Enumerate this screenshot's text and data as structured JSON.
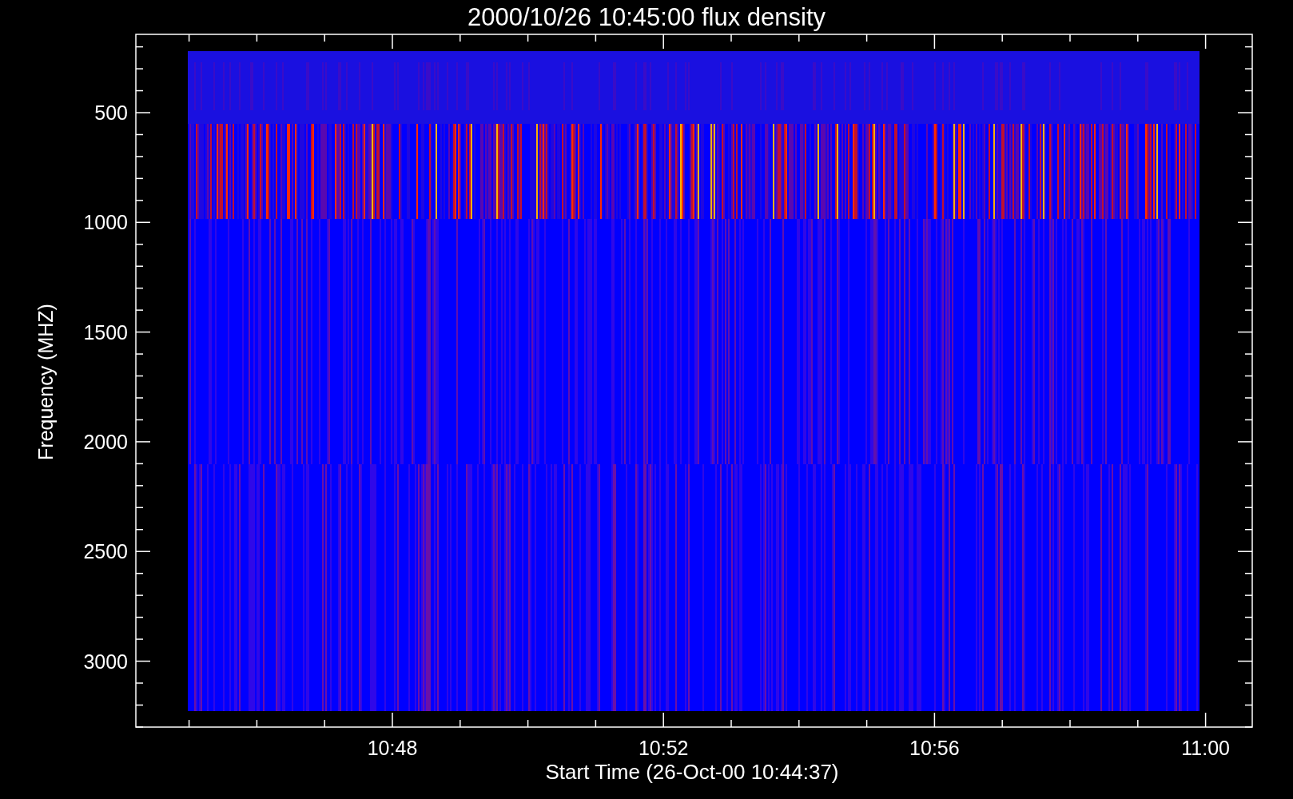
{
  "plot": {
    "title": "2000/10/26 10:45:00 flux density",
    "xlabel": "Start Time (26-Oct-00 10:44:37)",
    "ylabel": "Frequency (MHZ)",
    "xtick_labels": [
      "10:48",
      "10:52",
      "10:56",
      "11:00"
    ],
    "ytick_labels": [
      "500",
      "1000",
      "1500",
      "2000",
      "2500",
      "3000"
    ]
  }
}
